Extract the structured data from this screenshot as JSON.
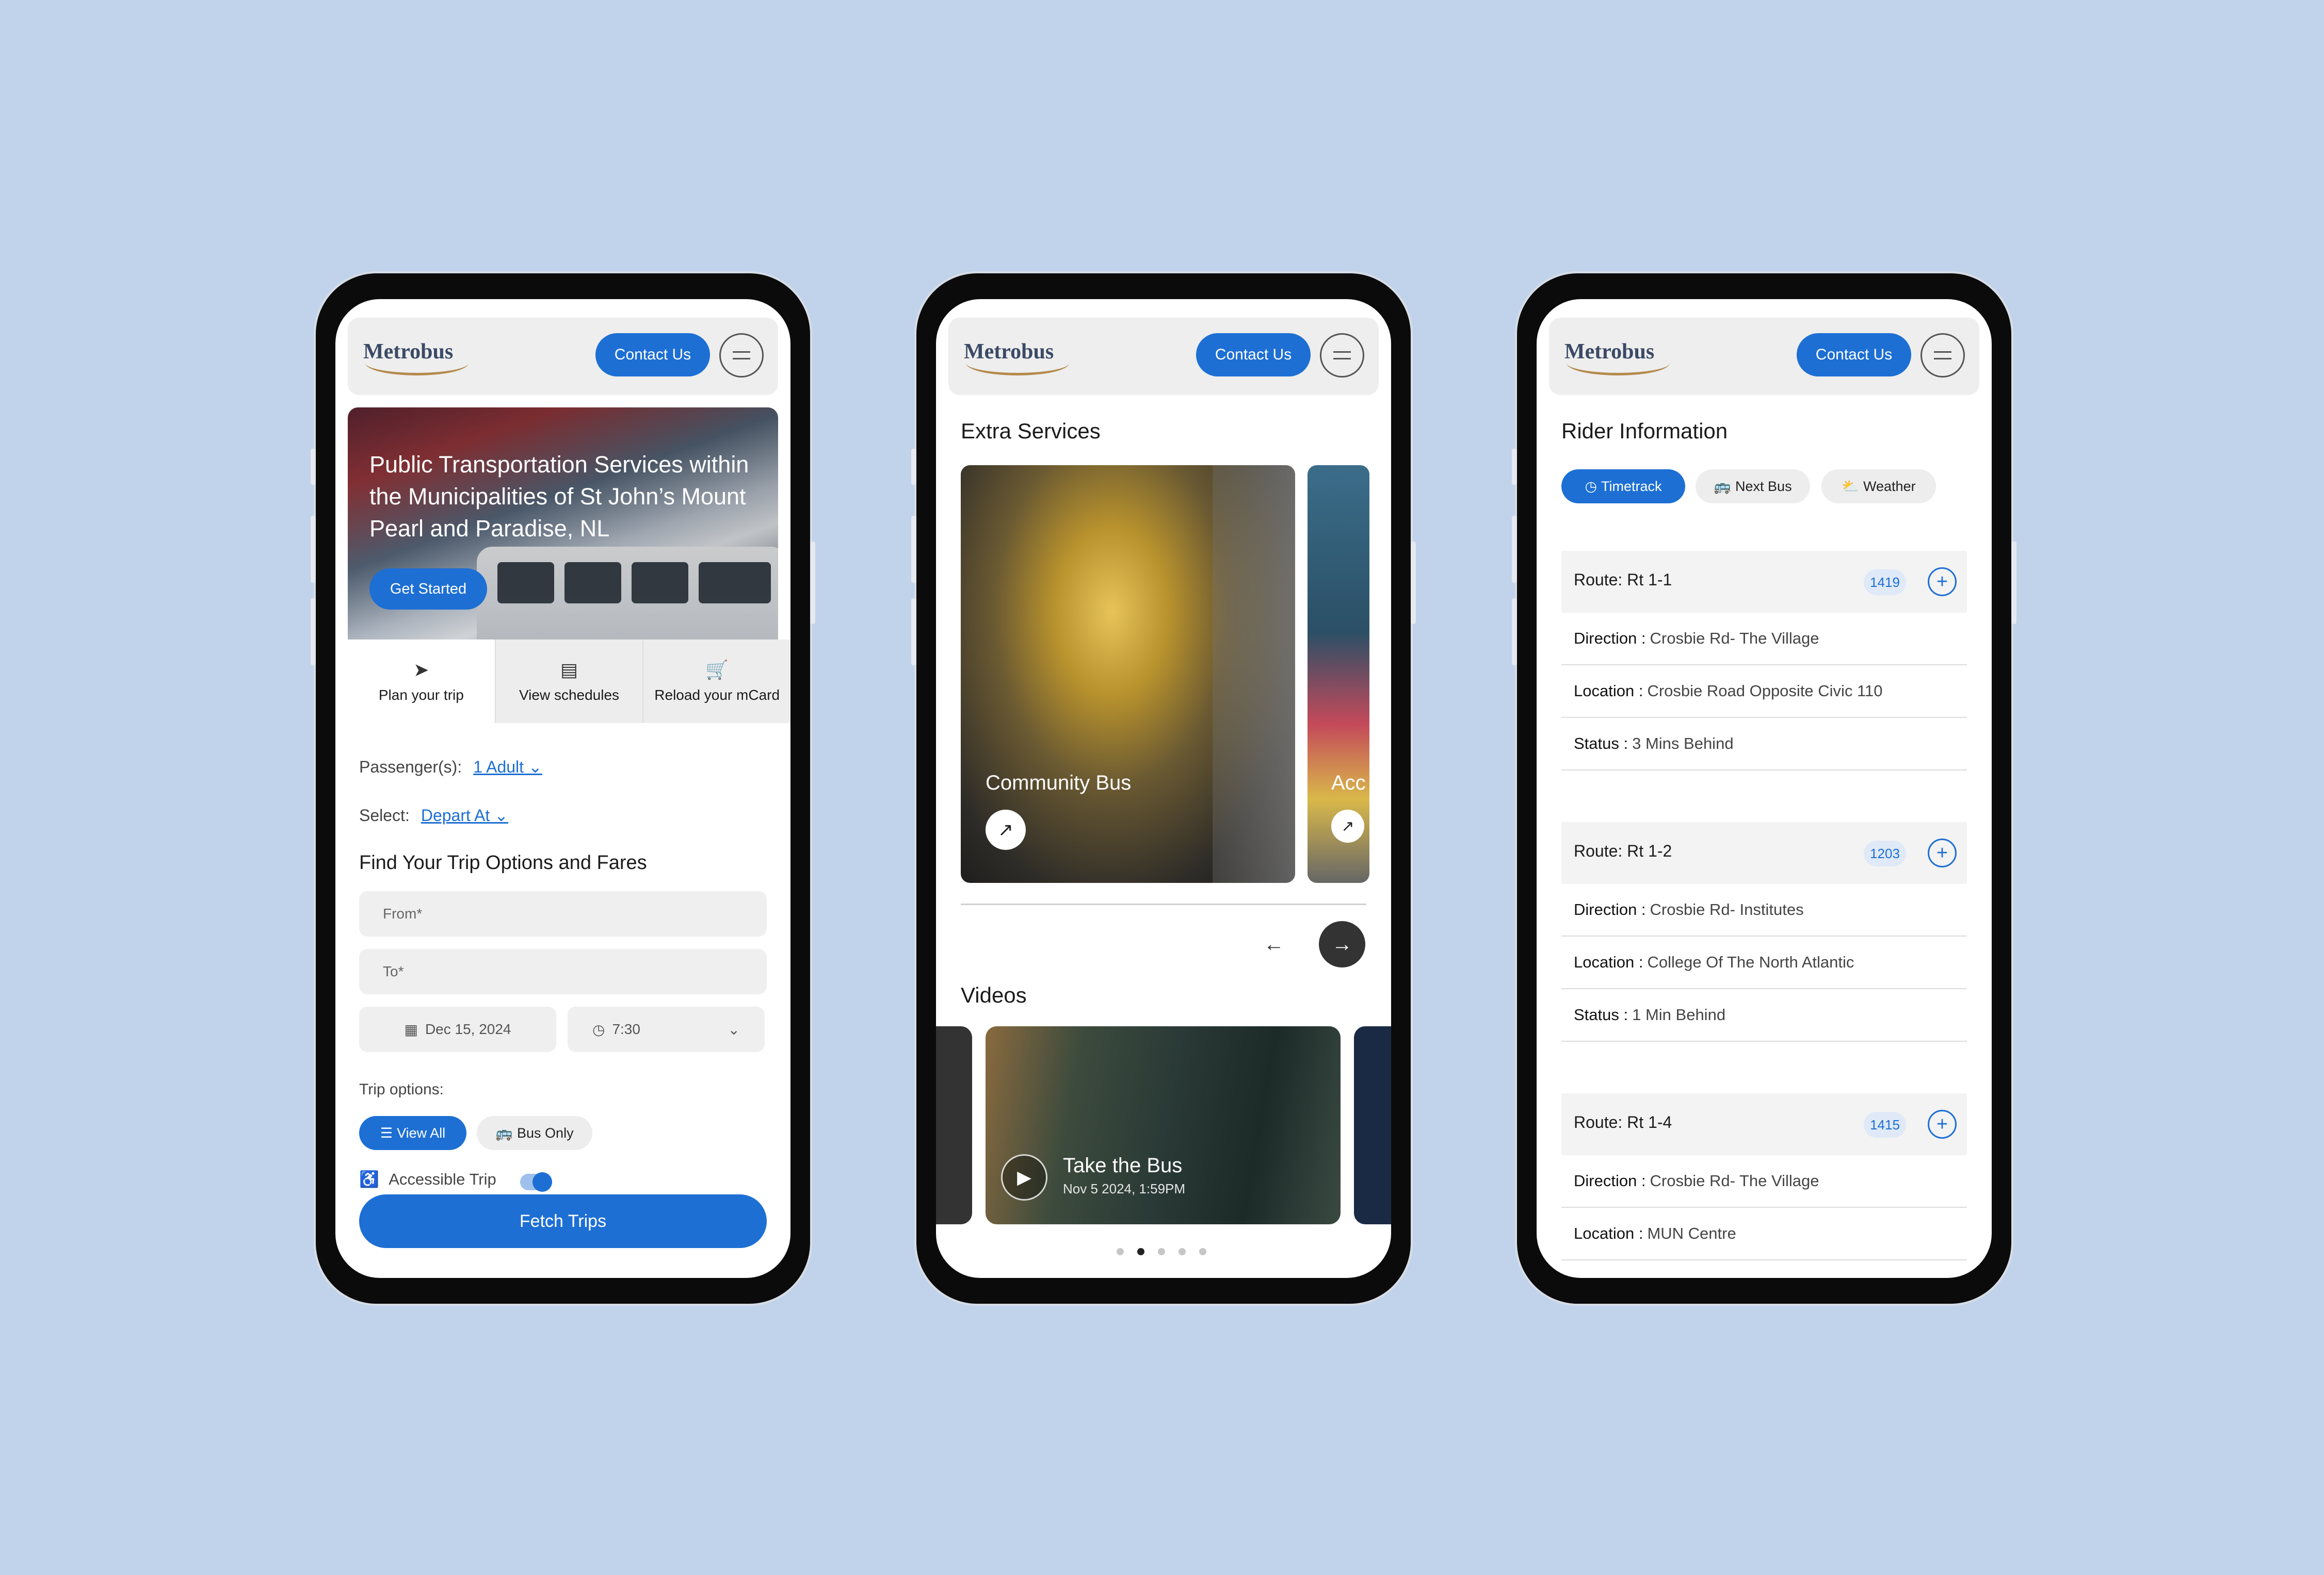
{
  "header": {
    "logo": "Metrobus",
    "contact": "Contact Us"
  },
  "home": {
    "hero_title": "Public Transportation Services within the Municipalities of St John’s Mount Pearl and Paradise, NL",
    "get_started": "Get Started",
    "tabs": [
      {
        "label": "Plan your trip",
        "icon": "navigation-arrow-icon"
      },
      {
        "label": "View schedules",
        "icon": "clipboard-icon"
      },
      {
        "label": "Reload your mCard",
        "icon": "cart-icon"
      }
    ],
    "passengers_label": "Passenger(s):",
    "passengers_value": "1 Adult",
    "select_label": "Select:",
    "select_value": "Depart At",
    "section_title": "Find Your Trip Options and  Fares",
    "from_placeholder": "From*",
    "to_placeholder": "To*",
    "date": "Dec 15, 2024",
    "time": "7:30",
    "trip_options_label": "Trip options:",
    "chip_all": "View All",
    "chip_bus": "Bus Only",
    "accessible": "Accessible Trip",
    "accessible_on": true,
    "fetch": "Fetch Trips"
  },
  "extra": {
    "title": "Extra Services",
    "card1": "Community Bus",
    "card2": "Acc",
    "videos_title": "Videos",
    "video_title": "Take the Bus",
    "video_date": "Nov 5 2024, 1:59PM",
    "active_dot": 2,
    "dot_count": 5
  },
  "rider": {
    "title": "Rider Information",
    "tabs": [
      {
        "label": "Timetrack",
        "icon": "clock-icon",
        "active": true
      },
      {
        "label": "Next Bus",
        "icon": "bus-icon",
        "active": false
      },
      {
        "label": "Weather",
        "icon": "cloud-sun-icon",
        "active": false
      }
    ],
    "direction_label": "Direction :",
    "location_label": "Location :",
    "status_label": "Status :",
    "routes": [
      {
        "name": "Route: Rt 1-1",
        "num": "1419",
        "direction": "Crosbie Rd- The Village",
        "location": "Crosbie Road Opposite Civic 110",
        "status": "3 Mins Behind"
      },
      {
        "name": "Route: Rt 1-2",
        "num": "1203",
        "direction": "Crosbie Rd- Institutes",
        "location": "College Of The North Atlantic",
        "status": "1 Min Behind"
      },
      {
        "name": "Route: Rt 1-4",
        "num": "1415",
        "direction": "Crosbie Rd- The Village",
        "location": "MUN Centre"
      }
    ]
  },
  "colors": {
    "accent": "#1d6fd4",
    "background": "#c1d3ea"
  }
}
